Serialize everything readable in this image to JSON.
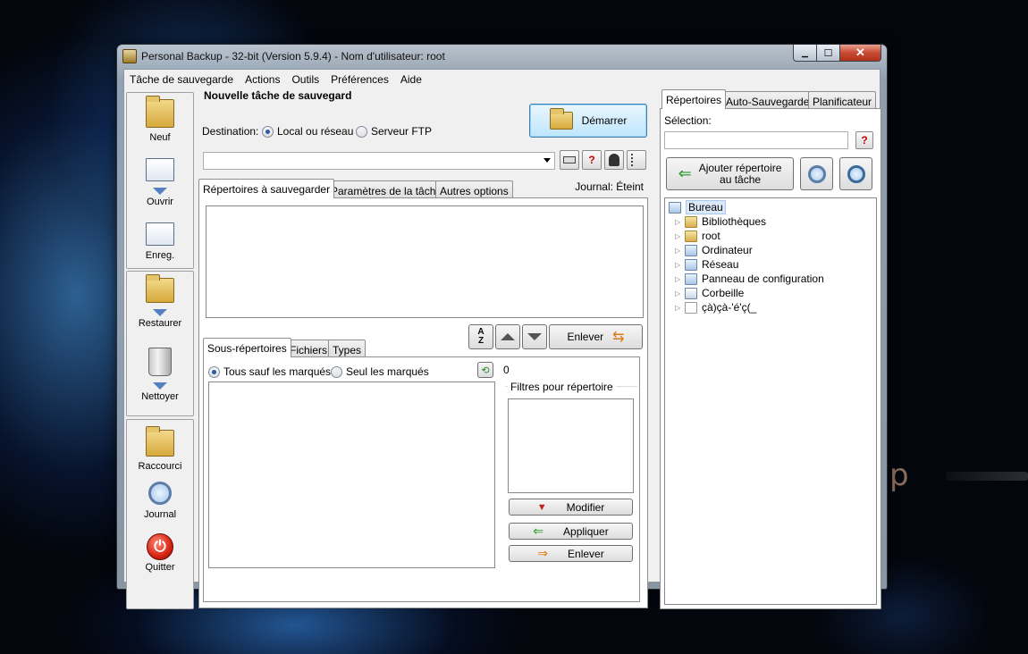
{
  "window": {
    "title": "Personal Backup - 32-bit (Version 5.9.4) - Nom d'utilisateur: root",
    "controls": {
      "minimize": "▁",
      "maximize": "☐",
      "close": "✕"
    }
  },
  "menu": [
    "Tâche de sauvegarde",
    "Actions",
    "Outils",
    "Préférences",
    "Aide"
  ],
  "toolbar": {
    "new": "Neuf",
    "open": "Ouvrir",
    "save": "Enreg.",
    "restore": "Restaurer",
    "clean": "Nettoyer",
    "shortcut": "Raccourci",
    "log": "Journal",
    "quit": "Quitter"
  },
  "task": {
    "title": "Nouvelle tâche de sauvegard",
    "destination_label": "Destination:",
    "dest_local": "Local ou réseau",
    "dest_ftp": "Serveur FTP",
    "start_button": "Démarrer",
    "combo_value": "",
    "help_glyph": "?"
  },
  "tabs": [
    "Répertoires à sauvegarder",
    "Paramètres de la tâche",
    "Autres options"
  ],
  "journal_status": "Journal: Éteint",
  "remove_button": "Enlever",
  "subtabs": [
    "Sous-répertoires",
    "Fichiers",
    "Types"
  ],
  "sub": {
    "radio_all": "Tous sauf les marqués",
    "radio_only": "Seul les marqués",
    "count": "0",
    "filters_label": "Filtres pour répertoire",
    "modify": "Modifier",
    "apply": "Appliquer",
    "remove": "Enlever"
  },
  "right_tabs": [
    "Répertoires",
    "Auto-Sauvegarde",
    "Planificateur"
  ],
  "selection_label": "Sélection:",
  "selection_value": "",
  "add_dir_button": {
    "line1": "Ajouter répertoire",
    "line2": "au tâche"
  },
  "tree": {
    "root": "Bureau",
    "items": [
      "Bibliothèques",
      "root",
      "Ordinateur",
      "Réseau",
      "Panneau de configuration",
      "Corbeille",
      "çà)çà-'é'ç(_"
    ]
  },
  "colors": {
    "accent": "#3c7fb1",
    "close_button": "#c74a33"
  }
}
